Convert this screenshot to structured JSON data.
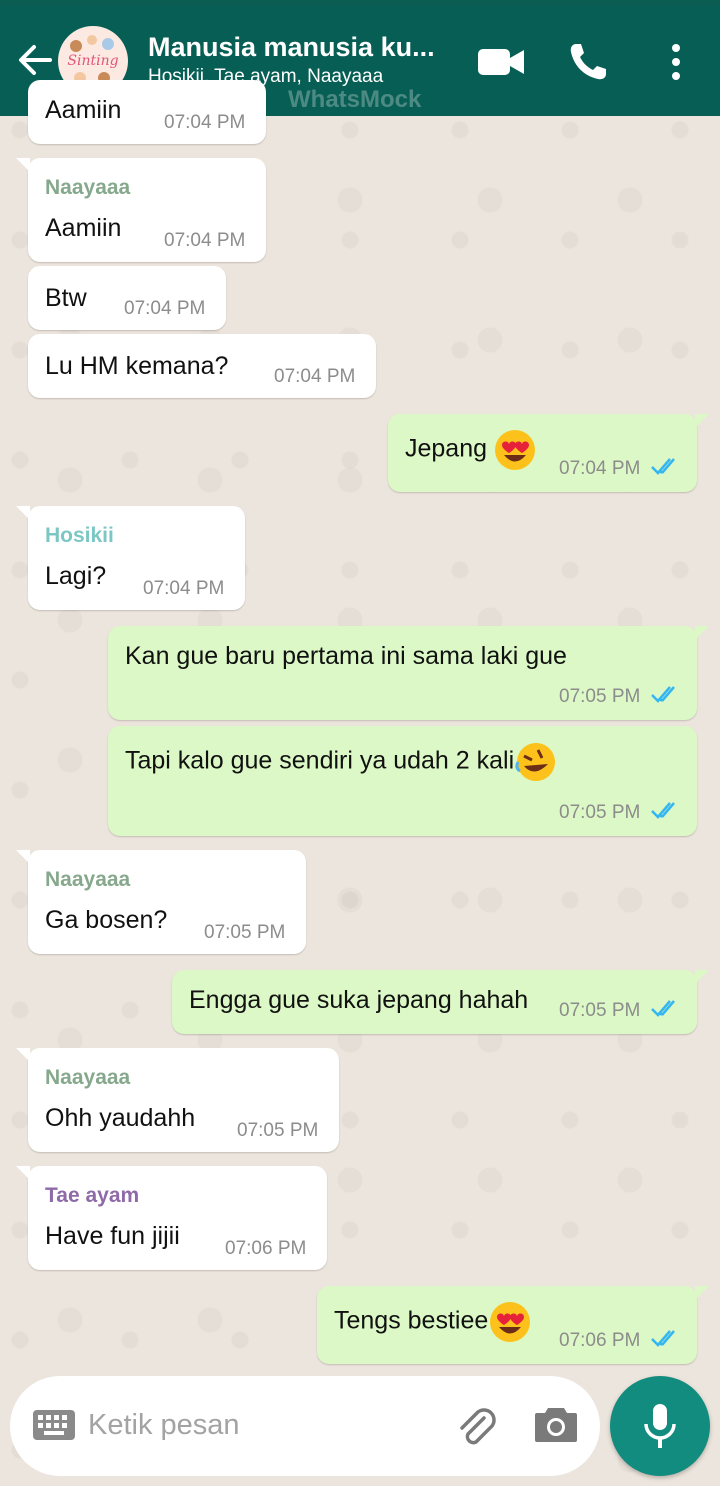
{
  "header": {
    "title": "Manusia manusia ku...",
    "subtitle": "Hosikii, Tae ayam, Naayaaa",
    "watermark": "WhatsMock",
    "avatar_text": "Sinting"
  },
  "colors": {
    "header_bg": "#075e54",
    "incoming_bubble": "#ffffff",
    "outgoing_bubble": "#dcf8c6",
    "tick_blue": "#34b7f1",
    "naayaaa": "#86a88c",
    "hosikii": "#7cc7c3",
    "tae_ayam": "#8e6aa8",
    "mic_button": "#128c7e"
  },
  "messages": [
    {
      "direction": "in",
      "text": "Aamiin",
      "time": "07:04 PM"
    },
    {
      "direction": "in",
      "sender": "Naayaaa",
      "text": "Aamiin",
      "time": "07:04 PM"
    },
    {
      "direction": "in",
      "text": "Btw",
      "time": "07:04 PM"
    },
    {
      "direction": "in",
      "text": "Lu HM kemana?",
      "time": "07:04 PM"
    },
    {
      "direction": "out",
      "text": "Jepang",
      "emoji": "heart-eyes-emoji",
      "time": "07:04 PM",
      "status": "read"
    },
    {
      "direction": "in",
      "sender": "Hosikii",
      "text": "Lagi?",
      "time": "07:04 PM"
    },
    {
      "direction": "out",
      "text": "Kan gue baru pertama ini sama laki gue",
      "time": "07:05 PM",
      "status": "read"
    },
    {
      "direction": "out",
      "text": "Tapi kalo gue sendiri ya udah 2 kali",
      "emoji": "rolling-laughing-emoji",
      "time": "07:05 PM",
      "status": "read"
    },
    {
      "direction": "in",
      "sender": "Naayaaa",
      "text": "Ga bosen?",
      "time": "07:05 PM"
    },
    {
      "direction": "out",
      "text": "Engga gue suka jepang hahah",
      "time": "07:05 PM",
      "status": "read"
    },
    {
      "direction": "in",
      "sender": "Naayaaa",
      "text": "Ohh yaudahh",
      "time": "07:05 PM"
    },
    {
      "direction": "in",
      "sender": "Tae ayam",
      "text": "Have fun jijii",
      "time": "07:06 PM"
    },
    {
      "direction": "out",
      "text": "Tengs bestiee",
      "emoji": "heart-eyes-emoji",
      "time": "07:06 PM",
      "status": "read"
    }
  ],
  "input": {
    "placeholder": "Ketik pesan"
  },
  "icons": [
    "back-arrow-icon",
    "video-call-icon",
    "phone-icon",
    "more-icon",
    "keyboard-icon",
    "attach-icon",
    "camera-icon",
    "mic-icon",
    "double-tick-icon"
  ]
}
